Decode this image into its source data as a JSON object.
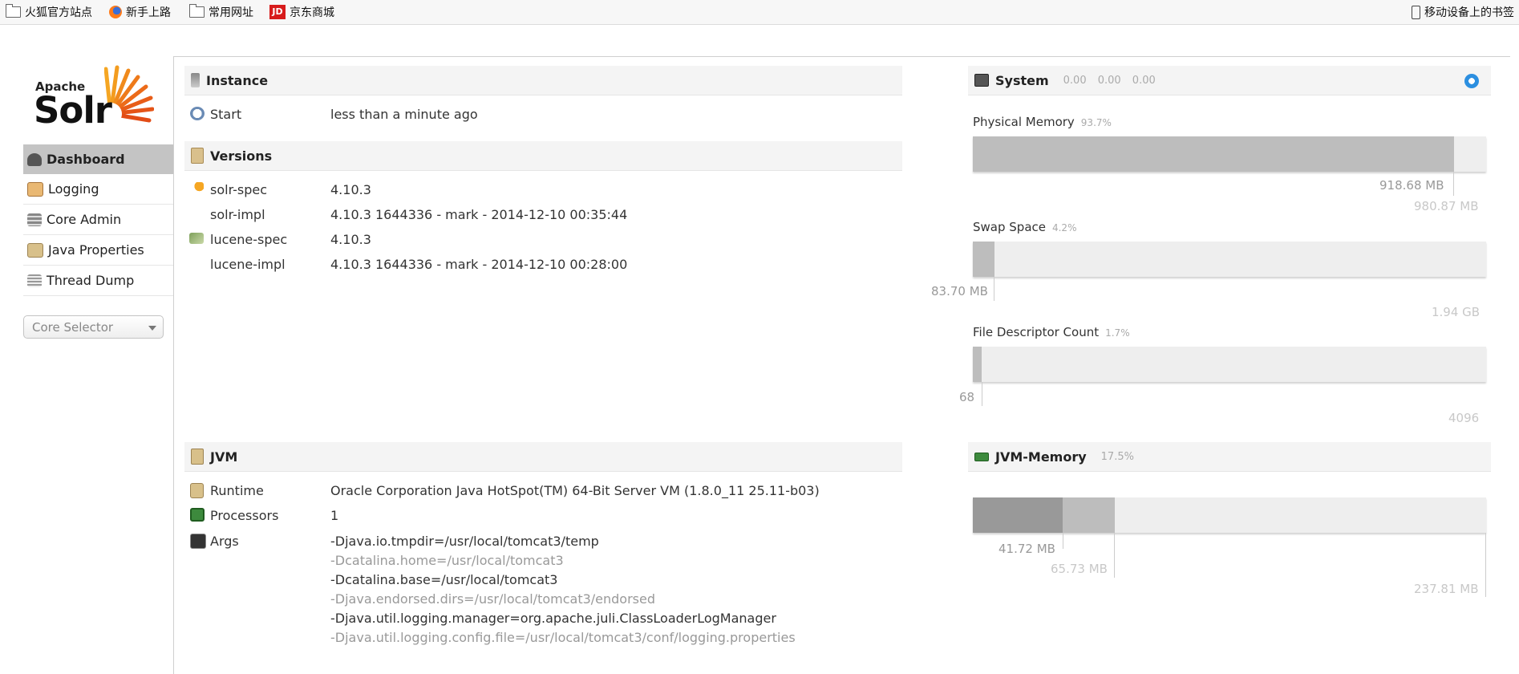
{
  "bookmarks": {
    "items": [
      {
        "label": "火狐官方站点",
        "icon": "folder-icon"
      },
      {
        "label": "新手上路",
        "icon": "firefox-icon"
      },
      {
        "label": "常用网址",
        "icon": "folder-icon"
      },
      {
        "label": "京东商城",
        "icon": "jd-icon",
        "icon_text": "JD"
      }
    ],
    "mobile": {
      "label": "移动设备上的书签",
      "icon": "phone-icon"
    }
  },
  "logo": {
    "apache": "Apache",
    "solr": "Solr"
  },
  "nav": {
    "items": [
      {
        "label": "Dashboard",
        "icon": "dashboard-icon",
        "active": true
      },
      {
        "label": "Logging",
        "icon": "logging-icon"
      },
      {
        "label": "Core Admin",
        "icon": "core-admin-icon"
      },
      {
        "label": "Java Properties",
        "icon": "java-properties-icon"
      },
      {
        "label": "Thread Dump",
        "icon": "thread-dump-icon"
      }
    ],
    "core_selector": "Core Selector"
  },
  "instance": {
    "title": "Instance",
    "start_label": "Start",
    "start_value": "less than a minute ago"
  },
  "versions": {
    "title": "Versions",
    "rows": [
      {
        "label": "solr-spec",
        "value": "4.10.3"
      },
      {
        "label": "solr-impl",
        "value": "4.10.3 1644336 - mark - 2014-12-10 00:35:44"
      },
      {
        "label": "lucene-spec",
        "value": "4.10.3"
      },
      {
        "label": "lucene-impl",
        "value": "4.10.3 1644336 - mark - 2014-12-10 00:28:00"
      }
    ]
  },
  "jvm": {
    "title": "JVM",
    "runtime_label": "Runtime",
    "runtime_value": "Oracle Corporation Java HotSpot(TM) 64-Bit Server VM (1.8.0_11 25.11-b03)",
    "processors_label": "Processors",
    "processors_value": "1",
    "args_label": "Args",
    "args": [
      "-Djava.io.tmpdir=/usr/local/tomcat3/temp",
      "-Dcatalina.home=/usr/local/tomcat3",
      "-Dcatalina.base=/usr/local/tomcat3",
      "-Djava.endorsed.dirs=/usr/local/tomcat3/endorsed",
      "-Djava.util.logging.manager=org.apache.juli.ClassLoaderLogManager",
      "-Djava.util.logging.config.file=/usr/local/tomcat3/conf/logging.properties"
    ]
  },
  "system": {
    "title": "System",
    "loads": "0.00 0.00 0.00",
    "physical": {
      "title": "Physical Memory",
      "pct": "93.7%",
      "fraction": 0.937,
      "used": "918.68 MB",
      "total": "980.87 MB"
    },
    "swap": {
      "title": "Swap Space",
      "pct": "4.2%",
      "fraction": 0.042,
      "used": "83.70 MB",
      "total": "1.94 GB"
    },
    "fd": {
      "title": "File Descriptor Count",
      "pct": "1.7%",
      "fraction": 0.017,
      "used": "68",
      "total": "4096"
    }
  },
  "jvm_memory": {
    "title": "JVM-Memory",
    "pct": "17.5%",
    "used_fraction": 0.175,
    "allocated_fraction": 0.276,
    "used": "41.72 MB",
    "allocated": "65.73 MB",
    "max": "237.81 MB"
  },
  "colors": {
    "accent": "#c4c4c4",
    "bar_fill": "#bdbdbd",
    "bar_track": "#eeeeee",
    "jvm_used": "#999999"
  }
}
